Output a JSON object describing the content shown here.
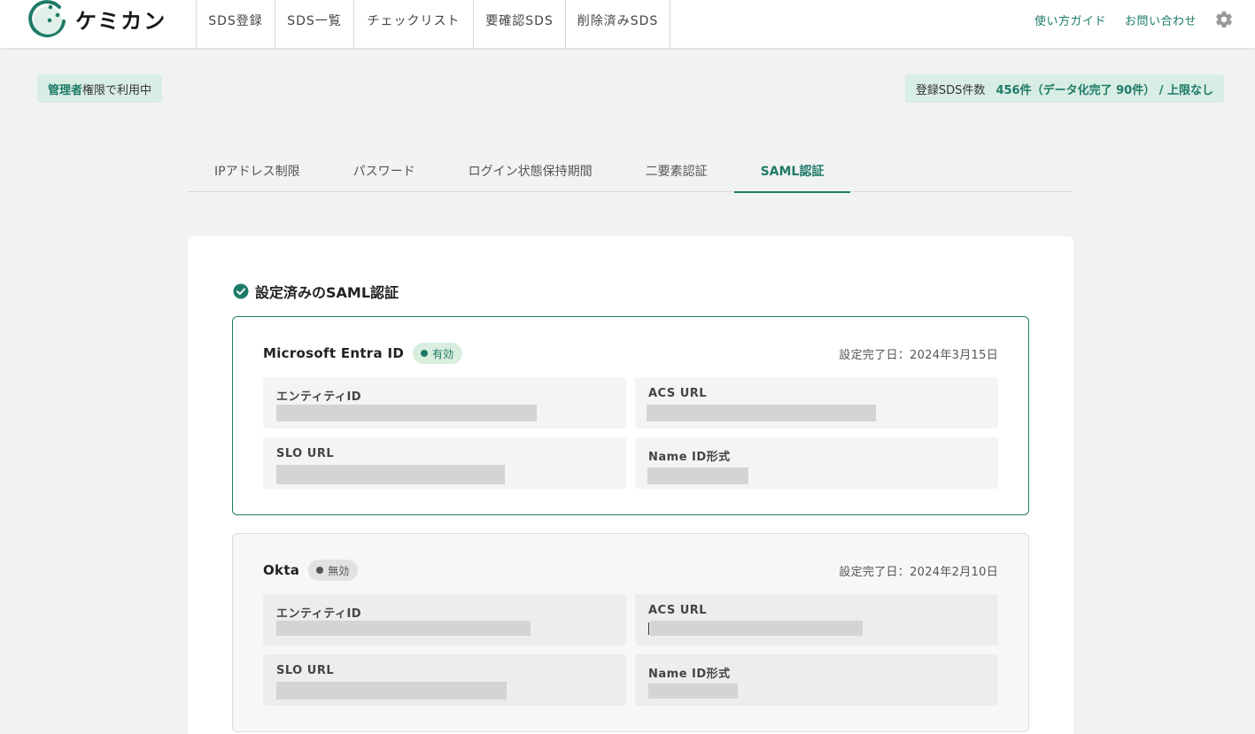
{
  "header": {
    "logo_text": "ケミカン",
    "nav": [
      {
        "label": "SDS登録"
      },
      {
        "label": "SDS一覧"
      },
      {
        "label": "チェックリスト"
      },
      {
        "label": "要確認SDS"
      },
      {
        "label": "削除済みSDS"
      }
    ],
    "links": {
      "guide": "使い方ガイド",
      "contact": "お問い合わせ"
    },
    "settings_icon": "gear-icon"
  },
  "status": {
    "admin_strong": "管理者",
    "admin_rest": "権限で利用中",
    "count_label": "登録SDS件数",
    "count_value": "456件（データ化完了 90件） / 上限なし"
  },
  "tabs": [
    {
      "label": "IPアドレス制限",
      "active": false
    },
    {
      "label": "パスワード",
      "active": false
    },
    {
      "label": "ログイン状態保持期間",
      "active": false
    },
    {
      "label": "二要素認証",
      "active": false
    },
    {
      "label": "SAML認証",
      "active": true
    }
  ],
  "section": {
    "title": "設定済みのSAML認証",
    "icon": "check-circle-icon"
  },
  "configs": [
    {
      "name": "Microsoft Entra ID",
      "status": "有効",
      "date": "設定完了日：2024年3月15日",
      "fields": {
        "entity": "エンティティID",
        "acs": "ACS URL",
        "slo": "SLO URL",
        "nameid": "Name ID形式"
      }
    },
    {
      "name": "Okta",
      "status": "無効",
      "date": "設定完了日：2024年2月10日",
      "fields": {
        "entity": "エンティティID",
        "acs": "ACS URL",
        "slo": "SLO URL",
        "nameid": "Name ID形式"
      }
    }
  ],
  "colors": {
    "accent": "#1e7b67",
    "badge_bg": "#d8ede4",
    "page_bg": "#f1f3f3"
  }
}
